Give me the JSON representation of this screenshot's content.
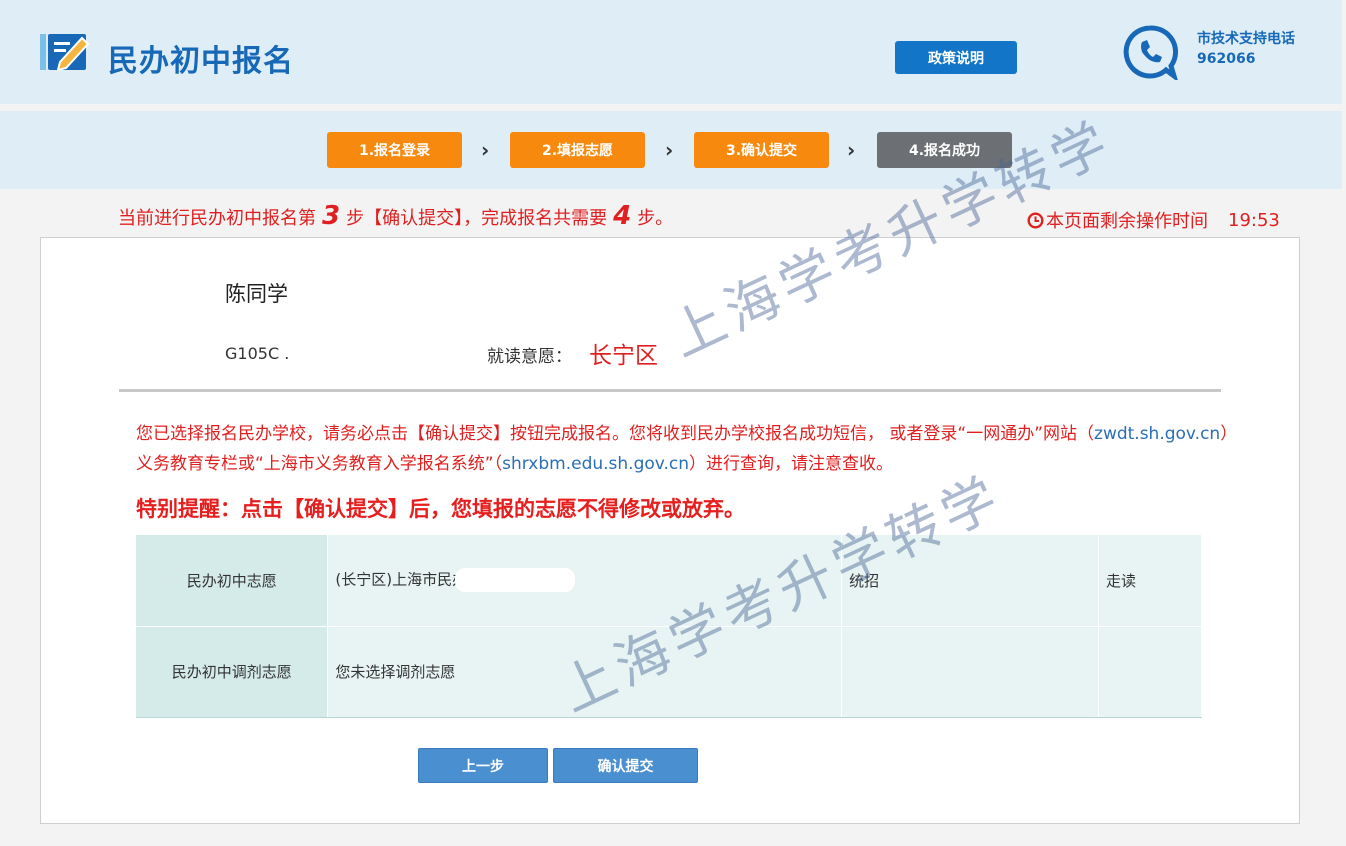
{
  "header": {
    "title": "民办初中报名",
    "policy_button": "政策说明",
    "support_label": "市技术支持电话",
    "support_phone": "962066"
  },
  "steps": [
    {
      "label": "1.报名登录",
      "state": "done"
    },
    {
      "label": "2.填报志愿",
      "state": "done"
    },
    {
      "label": "3.确认提交",
      "state": "current"
    },
    {
      "label": "4.报名成功",
      "state": "pending"
    }
  ],
  "progress": {
    "prefix": "当前进行民办初中报名第",
    "current_step": "3",
    "middle": "步【确认提交】，完成报名共需要",
    "total_steps": "4",
    "suffix": "步。",
    "timer_label": "本页面剩余操作时间",
    "timer_value": "19:53"
  },
  "student": {
    "name": "陈同学",
    "id": "G105C .",
    "intent_label": "就读意愿：",
    "intent_value": "长宁区"
  },
  "notice": {
    "part1": "您已选择报名民办学校，请务必点击【确认提交】按钮完成报名。您将收到民办学校报名成功短信， 或者登录“一网通办”网站（",
    "link1": "zwdt.sh.gov.cn",
    "part2": "）义务教育专栏或“上海市义务教育入学报名系统”（",
    "link2": "shrxbm.edu.sh.gov.cn",
    "part3": "）进行查询，请注意查收。",
    "warning": "特别提醒：点击【确认提交】后，您填报的志愿不得修改或放弃。"
  },
  "table": {
    "rows": [
      {
        "head": "民办初中志愿",
        "school": "(长宁区)上海市民办",
        "type": "统招",
        "mode": "走读"
      },
      {
        "head": "民办初中调剂志愿",
        "school": "您未选择调剂志愿",
        "type": "",
        "mode": ""
      }
    ]
  },
  "buttons": {
    "prev": "上一步",
    "submit": "确认提交"
  },
  "watermark": "上海学考升学转学",
  "colors": {
    "brand": "#1769b8",
    "step_active": "#f6890e",
    "step_pending": "#6c6f73",
    "alert": "#e02020"
  }
}
